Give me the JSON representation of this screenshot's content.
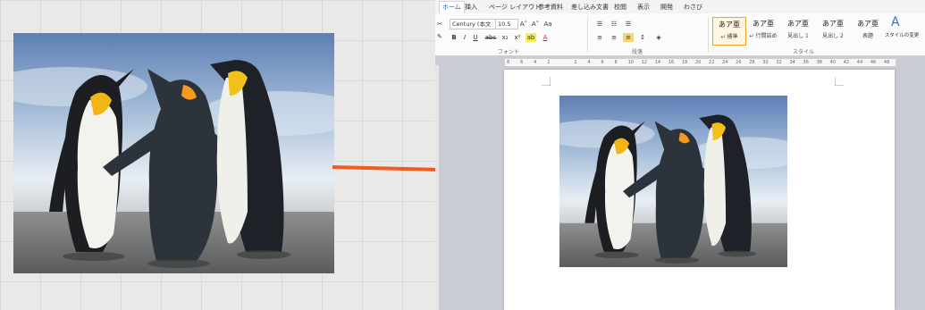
{
  "word": {
    "tabs": [
      "ホーム",
      "挿入",
      "ページ レイアウト",
      "参考資料",
      "差し込み文書",
      "校閲",
      "表示",
      "開発",
      "わさび"
    ],
    "ribbon": {
      "font_name": "Century (本文",
      "font_size": "10.5",
      "grow_font": "A˄",
      "shrink_font": "A˅",
      "clear_format": "Aa",
      "bold": "B",
      "italic": "I",
      "underline": "U",
      "strike": "abc",
      "subscript": "x₂",
      "superscript": "x²",
      "font_color": "A",
      "group_font": "フォント",
      "group_paragraph": "段落",
      "group_style": "スタイル",
      "styles": [
        {
          "sample": "あア亜",
          "name": "↵ 標準"
        },
        {
          "sample": "あア亜",
          "name": "↵ 行間詰め"
        },
        {
          "sample": "あア亜",
          "name": "見出し 1"
        },
        {
          "sample": "あア亜",
          "name": "見出し 2"
        },
        {
          "sample": "あア亜",
          "name": "表題"
        }
      ],
      "change_styles": "スタイルの変更"
    },
    "ruler_ticks": [
      "8",
      "6",
      "4",
      "2",
      "",
      "2",
      "4",
      "6",
      "8",
      "10",
      "12",
      "14",
      "16",
      "18",
      "20",
      "22",
      "24",
      "26",
      "28",
      "30",
      "32",
      "34",
      "36",
      "38",
      "40",
      "42",
      "44",
      "46",
      "48"
    ]
  }
}
